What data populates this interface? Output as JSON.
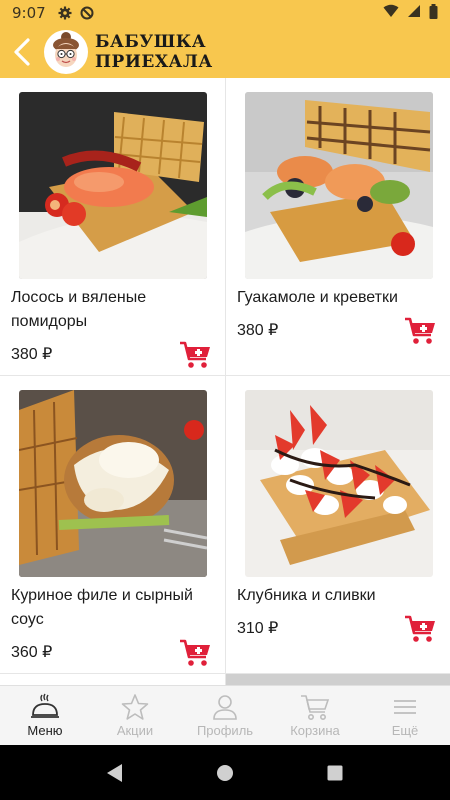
{
  "status_bar": {
    "time": "9:07"
  },
  "header": {
    "brand_line1": "БАБУШКА",
    "brand_line2": "ПРИЕХАЛА"
  },
  "colors": {
    "header_bg": "#f8c74e",
    "cart_red": "#e0203a",
    "active_nav": "#222222",
    "inactive_nav": "#b7b7b7"
  },
  "products": [
    {
      "name": "Лосось и вяленые помидоры",
      "price": "380 ₽",
      "image": "waffle-salmon-tomatoes-photo"
    },
    {
      "name": "Гуакамоле и креветки",
      "price": "380 ₽",
      "image": "waffle-guacamole-shrimp-photo"
    },
    {
      "name": "Куриное филе и сырный соус",
      "price": "360 ₽",
      "image": "waffle-chicken-cheese-sauce-photo"
    },
    {
      "name": "Клубника и сливки",
      "price": "310 ₽",
      "image": "waffle-strawberry-cream-photo"
    }
  ],
  "bottom_nav": [
    {
      "label": "Меню",
      "icon": "cloche-icon",
      "active": true
    },
    {
      "label": "Акции",
      "icon": "star-icon",
      "active": false
    },
    {
      "label": "Профиль",
      "icon": "person-icon",
      "active": false
    },
    {
      "label": "Корзина",
      "icon": "cart-icon",
      "active": false
    },
    {
      "label": "Ещё",
      "icon": "menu-icon",
      "active": false
    }
  ]
}
